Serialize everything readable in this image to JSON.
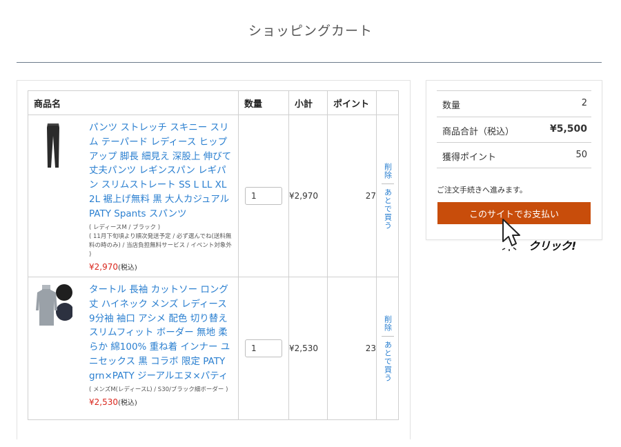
{
  "page": {
    "title": "ショッピングカート"
  },
  "cart": {
    "headers": {
      "name": "商品名",
      "qty": "数量",
      "subtotal": "小計",
      "points": "ポイント"
    },
    "items": [
      {
        "name": "パンツ ストレッチ スキニー スリム テーパード レディース ヒップアップ 脚長 細見え 深股上 伸びて丈夫パンツ レギンスパン レギパン スリムストレート SS L LL XL 2L 裾上げ無料 黒 大人カジュアル PATY Spants スパンツ",
        "option1": "( レディースM / ブラック )",
        "option2": "( 11月下旬頃より順次発送予定 / 必ず選んでね(送料無料の時のみ) / 当店負担無料サービス / イベント対象外 )",
        "price": "¥2,970",
        "tax": "(税込)",
        "qty": "1",
        "subtotal": "¥2,970",
        "points": "27",
        "delete_label": "削除",
        "later_label": "あとで買う",
        "thumb_icon": "black-pants-thumbnail-icon"
      },
      {
        "name": "タートル 長袖 カットソー ロング丈 ハイネック メンズ レディース 9分袖 袖口 アシメ 配色 切り替え スリムフィット ボーダー 無地 柔らか 綿100% 重ね着 インナー ユニセックス 黒 コラボ 限定 PATY grn×PATY ジーアルエヌ×パティ",
        "option1": "( メンズM(レディースL) / S30/ブラック細ボーダー )",
        "option2": "",
        "price": "¥2,530",
        "tax": "(税込)",
        "qty": "1",
        "subtotal": "¥2,530",
        "points": "23",
        "delete_label": "削除",
        "later_label": "あとで買う",
        "thumb_icon": "gray-turtleneck-thumbnail-icon"
      }
    ]
  },
  "summary": {
    "qty_label": "数量",
    "qty_value": "2",
    "total_label": "商品合計（税込）",
    "total_value": "¥5,500",
    "points_label": "獲得ポイント",
    "points_value": "50",
    "proceed_note": "ご注文手続きへ進みます。",
    "pay_button_label": "このサイトでお支払い"
  },
  "annotation": {
    "click_label": "クリック!",
    "cursor_icon": "mouse-pointer-icon"
  },
  "colors": {
    "link": "#2a7fd0",
    "price": "#d9261c",
    "button": "#c84d0b"
  }
}
